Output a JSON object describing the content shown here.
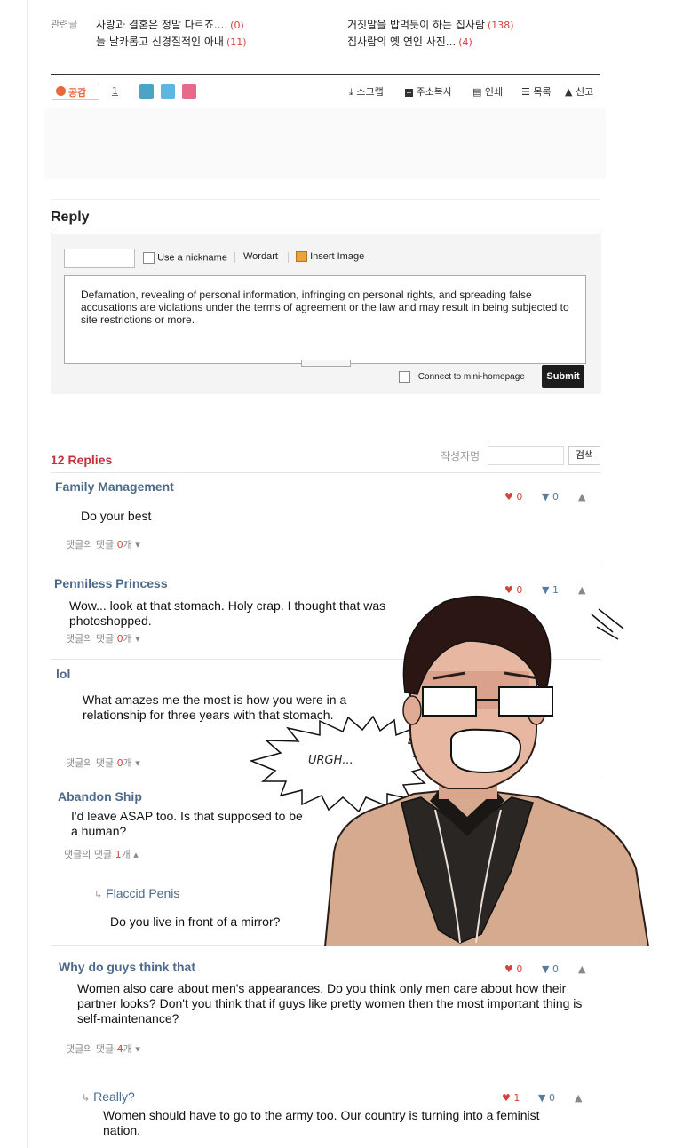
{
  "related": {
    "label": "관련글",
    "items": [
      {
        "title": "사랑과 결혼은 정말 다르죠....",
        "count": "(0)"
      },
      {
        "title": "늘 날카롭고 신경질적인 아내",
        "count": "(11)"
      },
      {
        "title": "거짓말을 밥먹듯이 하는 집사람",
        "count": "(138)"
      },
      {
        "title": "집사람의 옛 연인 사진...",
        "count": "(4)"
      }
    ]
  },
  "toolbar": {
    "empathy_label": "공감",
    "empathy_count": "1",
    "scrap": "스크랩",
    "copy_address": "주소복사",
    "print": "인쇄",
    "list": "목록",
    "report": "신고"
  },
  "reply_form": {
    "title": "Reply",
    "use_nickname": "Use a nickname",
    "wordart": "Wordart",
    "insert_image": "Insert Image",
    "notice": "Defamation, revealing of personal information, infringing on personal rights, and spreading false accusations are violations under the terms of agreement or the law and may result in being subjected to site restrictions or more.",
    "connect": "Connect to mini-homepage",
    "submit": "Submit"
  },
  "comments_header": {
    "count_label": "12 Replies",
    "author_search_label": "작성자명",
    "search_button": "검색"
  },
  "comments": [
    {
      "name": "Family Management",
      "text": "Do your best",
      "sub_prefix": "댓글의 댓글 ",
      "sub_count": "0",
      "sub_suffix": "개",
      "up": "0",
      "down": "0"
    },
    {
      "name": "Penniless Princess",
      "text": "Wow... look at that stomach. Holy crap. I thought that was photoshopped.",
      "sub_prefix": "댓글의 댓글 ",
      "sub_count": "0",
      "sub_suffix": "개",
      "up": "0",
      "down": "1"
    },
    {
      "name": "lol",
      "text": "What amazes me the most is how you were in a relationship for three years with that stomach.",
      "sub_prefix": "댓글의 댓글 ",
      "sub_count": "0",
      "sub_suffix": "개"
    },
    {
      "name": "Abandon Ship",
      "text": "I'd leave ASAP too. Is that supposed to be a human?",
      "sub_prefix": "댓글의 댓글 ",
      "sub_count": "1",
      "sub_suffix": "개"
    },
    {
      "name": "Why do guys think that",
      "text": "Women also care about men's appearances. Do you think only men care about how their partner looks? Don't you think that if guys like pretty women then the most important thing is self-maintenance?",
      "sub_prefix": "댓글의 댓글 ",
      "sub_count": "4",
      "sub_suffix": "개",
      "up": "0",
      "down": "0"
    }
  ],
  "replies": [
    {
      "name": "Flaccid Penis",
      "text": "Do you live in front of a mirror?"
    },
    {
      "name": "Really?",
      "text": "Women should have to go to the army too. Our country is turning into a feminist nation.",
      "up": "1",
      "down": "0"
    }
  ],
  "illustration": {
    "sfx": "URGH..."
  },
  "colors": {
    "accent_red": "#c3303a",
    "name_blue": "#4d6a8c"
  }
}
